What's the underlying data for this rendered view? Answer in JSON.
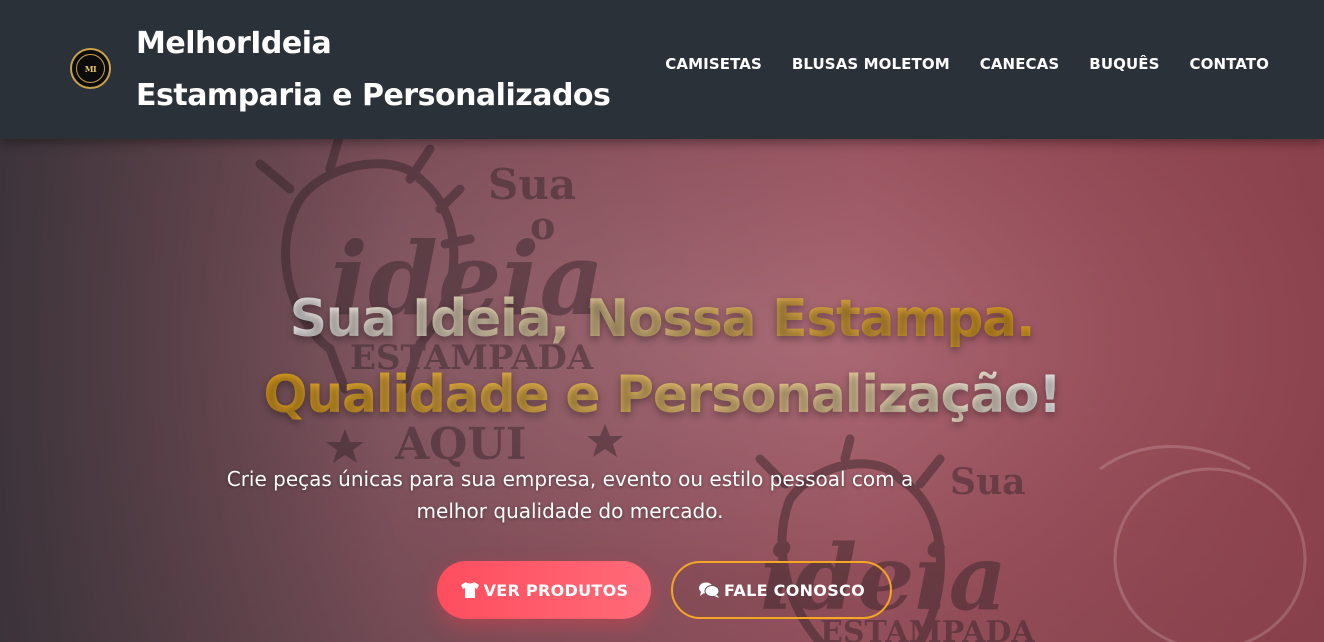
{
  "header": {
    "logo_text": "MI",
    "brand_line1": "MelhorIdeia",
    "brand_line2": "Estamparia e Personalizados",
    "nav": [
      {
        "label": "CAMISETAS"
      },
      {
        "label": "BLUSAS MOLETOM"
      },
      {
        "label": "CANECAS"
      },
      {
        "label": "BUQUÊS"
      },
      {
        "label": "CONTATO"
      }
    ]
  },
  "hero": {
    "title_line1": "Sua Ideia, Nossa Estampa.",
    "title_line2": "Qualidade e Personalização!",
    "subtitle": "Crie peças únicas para sua empresa, evento ou estilo pessoal com a melhor qualidade do mercado.",
    "buttons": {
      "primary": {
        "label": "VER PRODUTOS",
        "icon": "tshirt-icon"
      },
      "secondary": {
        "label": "FALE CONOSCO",
        "icon": "chat-bubbles-icon"
      }
    }
  },
  "colors": {
    "header_bg": "#2a3139",
    "primary_button": "#ff4d5e",
    "outline_accent": "#f5a623",
    "gold": "#d99a20"
  }
}
